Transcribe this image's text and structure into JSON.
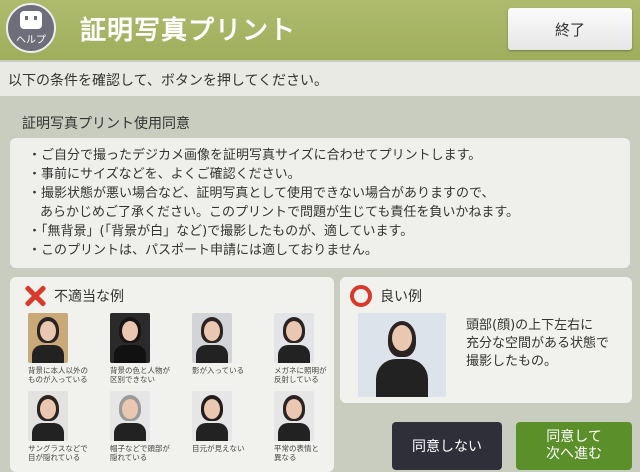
{
  "header": {
    "help_label": "ヘルプ",
    "title": "証明写真プリント",
    "end_button": "終了"
  },
  "instruction": "以下の条件を確認して、ボタンを押してください。",
  "terms": {
    "title": "証明写真プリント使用同意",
    "lines": [
      "・ご自分で撮ったデジカメ画像を証明写真サイズに合わせてプリントします。",
      "・事前にサイズなどを、よくご確認ください。",
      "・撮影状態が悪い場合など、証明写真として使用できない場合がありますので、",
      "あらかじめご了承ください。このプリントで問題が生じても責任を負いかねます。",
      "・「無背景」(「背景が白」など)で撮影したものが、適しています。",
      "・このプリントは、パスポート申請には適しておりません。"
    ]
  },
  "bad_examples": {
    "title": "不適当な例",
    "items": [
      {
        "caption": "背景に本人以外の\nものが入っている",
        "bg": "#c9a978",
        "hair": "#2b2222",
        "body": "#222"
      },
      {
        "caption": "背景の色と人物が\n区別できない",
        "bg": "#2a2a2a",
        "hair": "#1a1414",
        "body": "#111"
      },
      {
        "caption": "影が入っている",
        "bg": "#d2d4d8",
        "hair": "#2b2222",
        "body": "#222"
      },
      {
        "caption": "メガネに照明が\n反射している",
        "bg": "#e2e4e8",
        "hair": "#2b2222",
        "body": "#222"
      },
      {
        "caption": "サングラスなどで\n目が隠れている",
        "bg": "#e4e2e0",
        "hair": "#2b2222",
        "body": "#222"
      },
      {
        "caption": "帽子などで頭部が\n隠れている",
        "bg": "#e6e6e6",
        "hair": "#9a9a9a",
        "body": "#222"
      },
      {
        "caption": "目元が見えない",
        "bg": "#e6e6e6",
        "hair": "#241c1c",
        "body": "#222"
      },
      {
        "caption": "平常の表情と\n異なる",
        "bg": "#e6e6e6",
        "hair": "#2b2222",
        "body": "#222"
      }
    ]
  },
  "good_example": {
    "title": "良い例",
    "description": "頭部(顔)の上下左右に\n充分な空間がある状態で\n撮影したもの。"
  },
  "buttons": {
    "disagree": "同意しない",
    "agree_line1": "同意して",
    "agree_line2": "次へ進む"
  },
  "colors": {
    "header": "#a6b464",
    "agree": "#5a8f2a",
    "disagree": "#2f2f3a",
    "mark": "#d9392c"
  }
}
